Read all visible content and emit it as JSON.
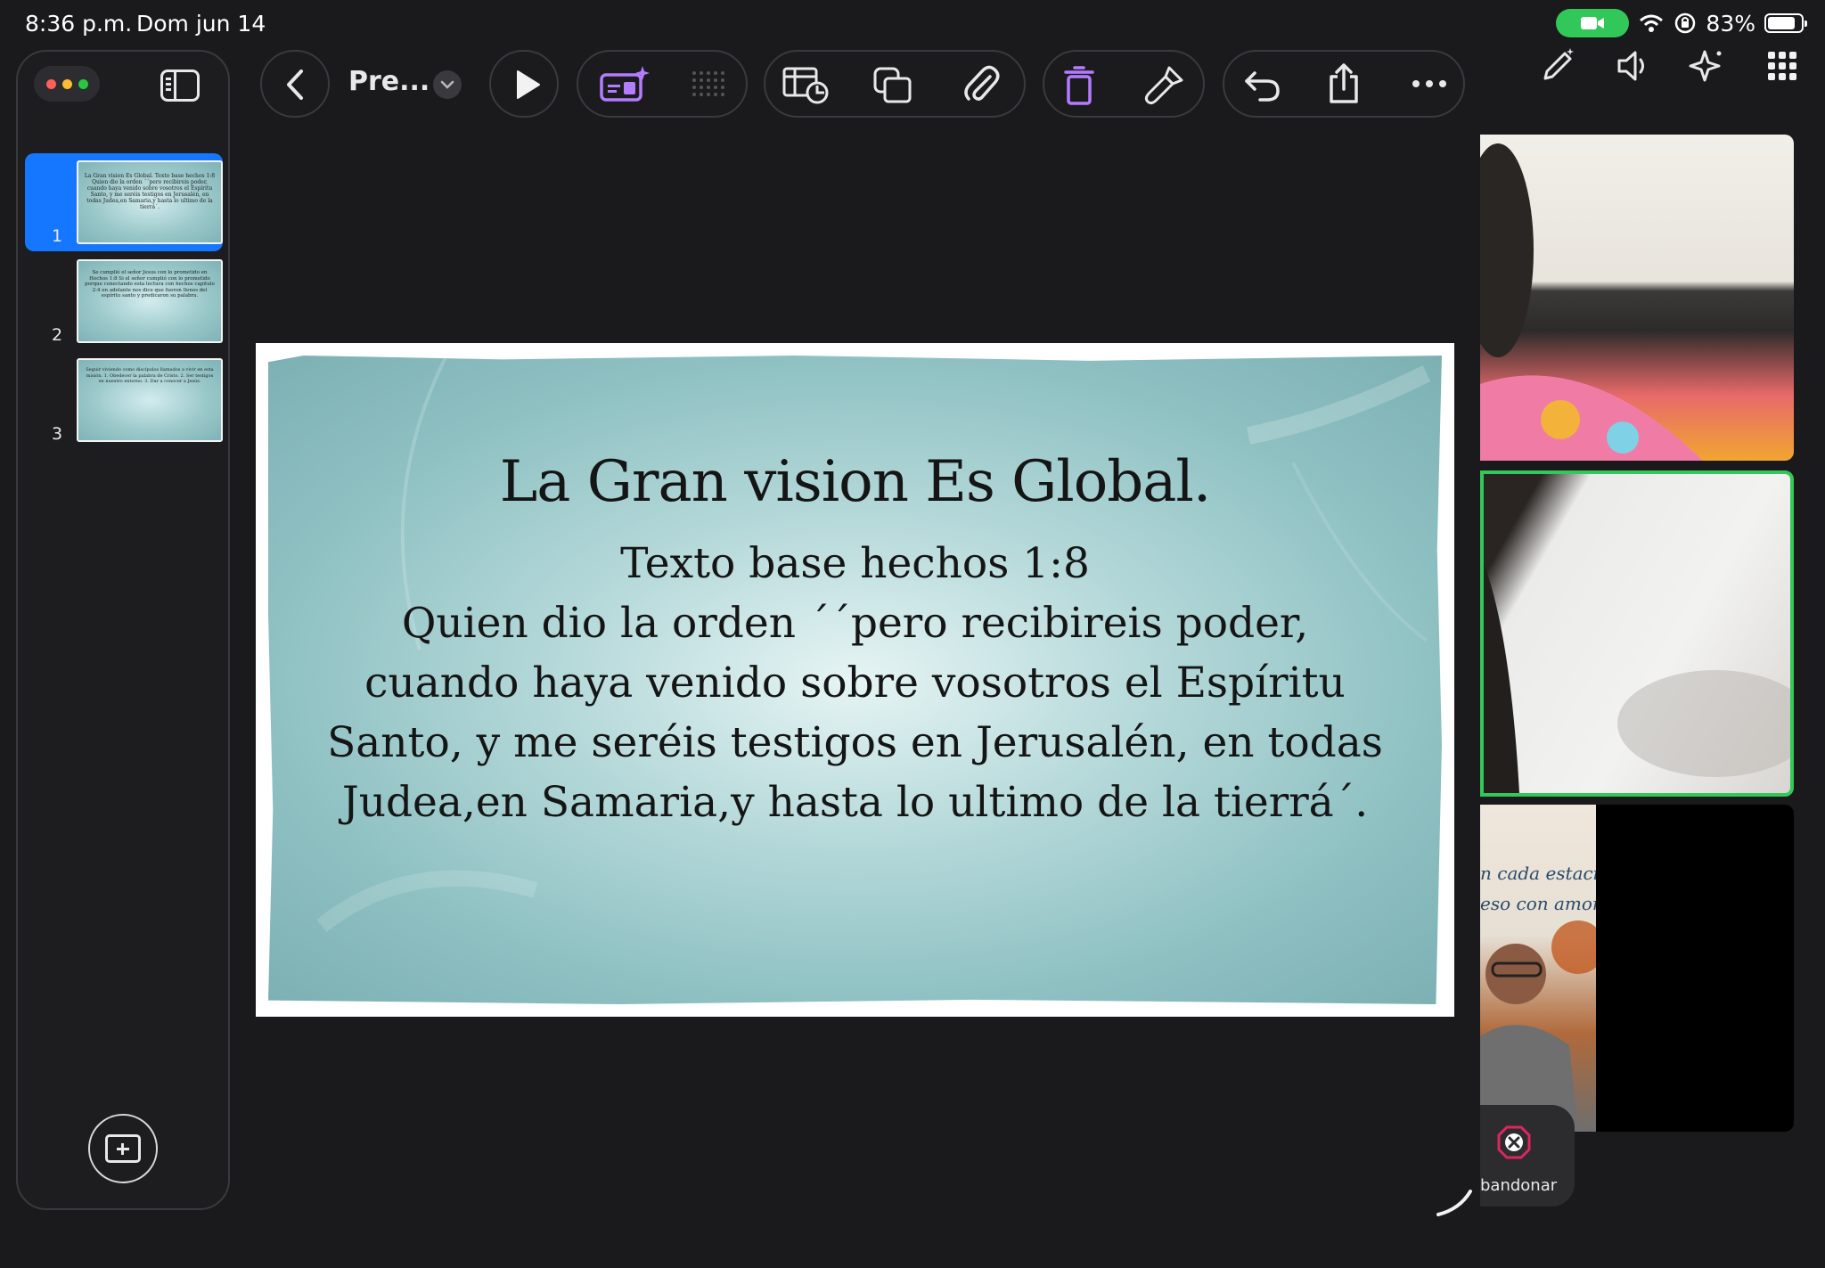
{
  "status_bar": {
    "time": "8:36 p.m.",
    "date": "Dom jun 14",
    "battery_percent": "83%",
    "battery_level": 0.83,
    "camera_indicator_color": "#32c759"
  },
  "toolbar": {
    "doc_title": "Pre...",
    "icons": [
      "back-chevron-icon",
      "title-dropdown-icon",
      "play-icon",
      "ai-slide-icon",
      "grid-dots-icon",
      "table-chart-icon",
      "shapes-icon",
      "attachment-icon",
      "delete-icon",
      "format-brush-icon",
      "undo-icon",
      "share-icon",
      "more-icon"
    ],
    "accent_color": "#b47cff"
  },
  "top_right": {
    "icons": [
      "markup-pen-icon",
      "speaker-icon",
      "sparkle-icon",
      "apps-grid-icon"
    ]
  },
  "sidebar": {
    "slides": [
      {
        "number": "1",
        "selected": true,
        "preview": "La Gran vision Es Global. Texto base hechos 1:8 Quien dio la orden ´´pero recibireis poder, cuando haya venido sobre vosotros el Espíritu Santo, y me seréis testigos en Jerusalén, en todas Judea,en Samaria,y hasta lo ultimo de la tierrá´."
      },
      {
        "number": "2",
        "selected": false,
        "preview": "Se cumplió el señor Jesus con lo prometido en Hechos 1:8 Si el señor cumplió con lo prometido porque conectando esta lectura con hechos capitulo 2:4 en adelante nos dice que fueron llenos del espíritu santo y predicaron su palabra."
      },
      {
        "number": "3",
        "selected": false,
        "preview": "Seguir viviendo como discípulos llamados a vivir en esta misión. 1. Obedecer la palabra de Cristo. 2. Ser testigos en nuestro entorno. 3. Dar a conocer a Jesús."
      }
    ],
    "selected_color": "#1577ff"
  },
  "slide": {
    "title": "La Gran vision Es Global.",
    "lines": [
      "Texto base hechos  1:8",
      "Quien dio la orden ´´pero recibireis poder,",
      "cuando haya venido sobre vosotros el Espíritu",
      "Santo, y me seréis  testigos en Jerusalén, en todas",
      "Judea,en Samaria,y hasta lo ultimo de la tierrá´."
    ],
    "background_color": "#9cc9cb"
  },
  "video_call": {
    "tile3_sign_lines": [
      "n cada estaci",
      "eso con amor"
    ],
    "active_speaker_color": "#34c759",
    "leave_label": "bandonar",
    "leave_color": "#e0245e"
  }
}
